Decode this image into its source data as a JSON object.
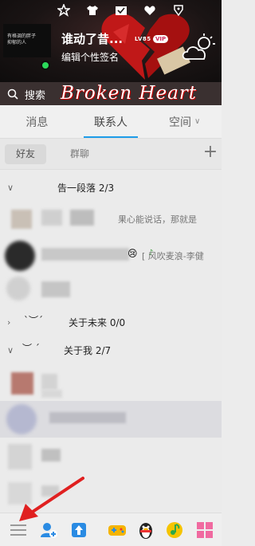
{
  "header": {
    "avatar_text": "有格调的胖子\n抑郁的人",
    "nickname": "谁动了昔...",
    "level_badge": "LV85",
    "vip_badge": "VIP",
    "signature": "编辑个性签名",
    "top_icons": [
      "star-icon",
      "shirt-icon",
      "mail-icon",
      "heart-icon",
      "skin-icon"
    ],
    "weather_icon": "cloud-sun-icon"
  },
  "search": {
    "label": "搜索"
  },
  "banner": {
    "text": "Broken Heart"
  },
  "tabs": [
    {
      "label": "消息",
      "active": false
    },
    {
      "label": "联系人",
      "active": true
    },
    {
      "label": "空间",
      "active": false
    }
  ],
  "subtabs": {
    "friends": "好友",
    "groups": "群聊"
  },
  "groups": {
    "g1": {
      "name": "告一段落  2/3"
    },
    "g2": {
      "wave": "ˋ︶ˊ",
      "name": "关于未来 0/0"
    },
    "g3": {
      "wave": "︶ ˊ",
      "name": "关于我 2/7"
    }
  },
  "contacts": {
    "c1_msg": "果心能说话，那就是",
    "c2_msg": "[ 风吹麦浪-李健"
  },
  "bottombar": [
    "menu-icon",
    "add-friend-icon",
    "upload-icon",
    "game-icon",
    "penguin-icon",
    "music-icon",
    "apps-icon"
  ],
  "colors": {
    "accent": "#1e9ce8",
    "online": "#2bd85a",
    "annotation_arrow": "#e02020"
  }
}
